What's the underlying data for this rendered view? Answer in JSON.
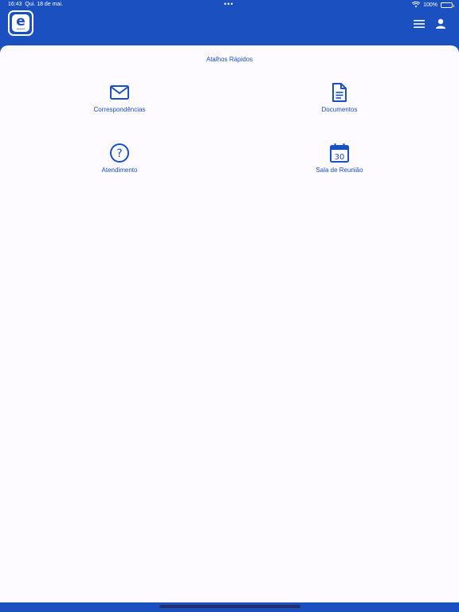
{
  "status": {
    "time": "16:43",
    "date": "Qui. 18 de mai.",
    "dots": "•••",
    "battery_text": "100%",
    "battery_level": 1.0
  },
  "header": {
    "logo_letter": "e",
    "logo_sub": "aaaaaa"
  },
  "main": {
    "title": "Atalhos Rápidos",
    "shortcuts": [
      {
        "label": "Correspondências",
        "icon": "mail-icon"
      },
      {
        "label": "Documentos",
        "icon": "document-icon"
      },
      {
        "label": "Atendimento",
        "icon": "help-icon"
      },
      {
        "label": "Sala de Reunião",
        "icon": "calendar-icon",
        "calendar_day": "30"
      }
    ]
  },
  "colors": {
    "primary": "#1a50c0",
    "background": "#fdfbff",
    "text_on_primary": "#ffffff"
  }
}
